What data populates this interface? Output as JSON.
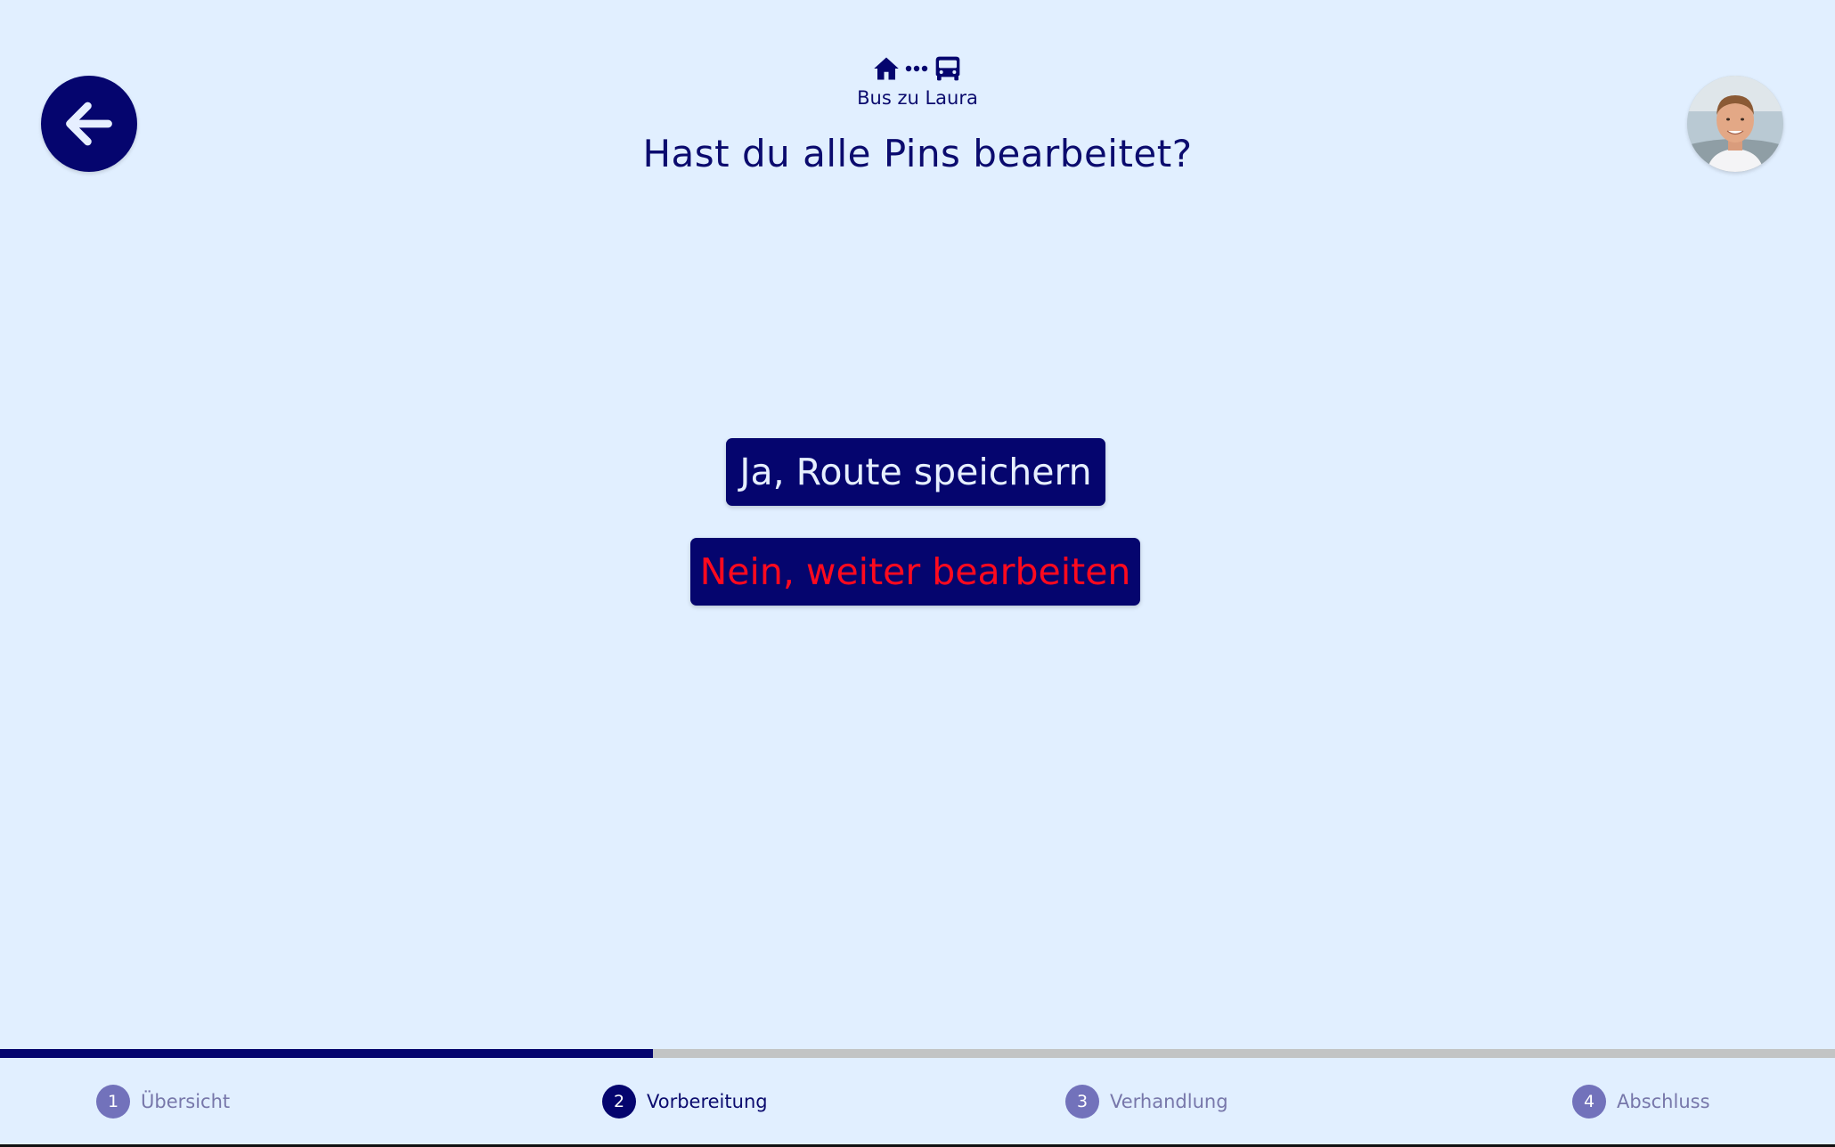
{
  "header": {
    "route_label": "Bus zu Laura",
    "title": "Hast du alle Pins bearbeitet?",
    "icons": [
      "home-icon",
      "dots-icon",
      "bus-icon"
    ]
  },
  "nav": {
    "back_icon": "arrow-left-icon"
  },
  "user": {
    "avatar": "user-avatar"
  },
  "actions": {
    "confirm_label": "Ja, Route speichern",
    "cancel_label": "Nein, weiter bearbeiten"
  },
  "progress": {
    "fraction": 0.356,
    "steps": [
      {
        "number": "1",
        "label": "Übersicht",
        "active": false
      },
      {
        "number": "2",
        "label": "Vorbereitung",
        "active": true
      },
      {
        "number": "3",
        "label": "Verhandlung",
        "active": false
      },
      {
        "number": "4",
        "label": "Abschluss",
        "active": false
      }
    ]
  },
  "colors": {
    "background": "#e1efff",
    "primary": "#05056e",
    "danger": "#ff0a1e",
    "inactive_step": "#7272bb",
    "track": "#c2c4c4"
  }
}
